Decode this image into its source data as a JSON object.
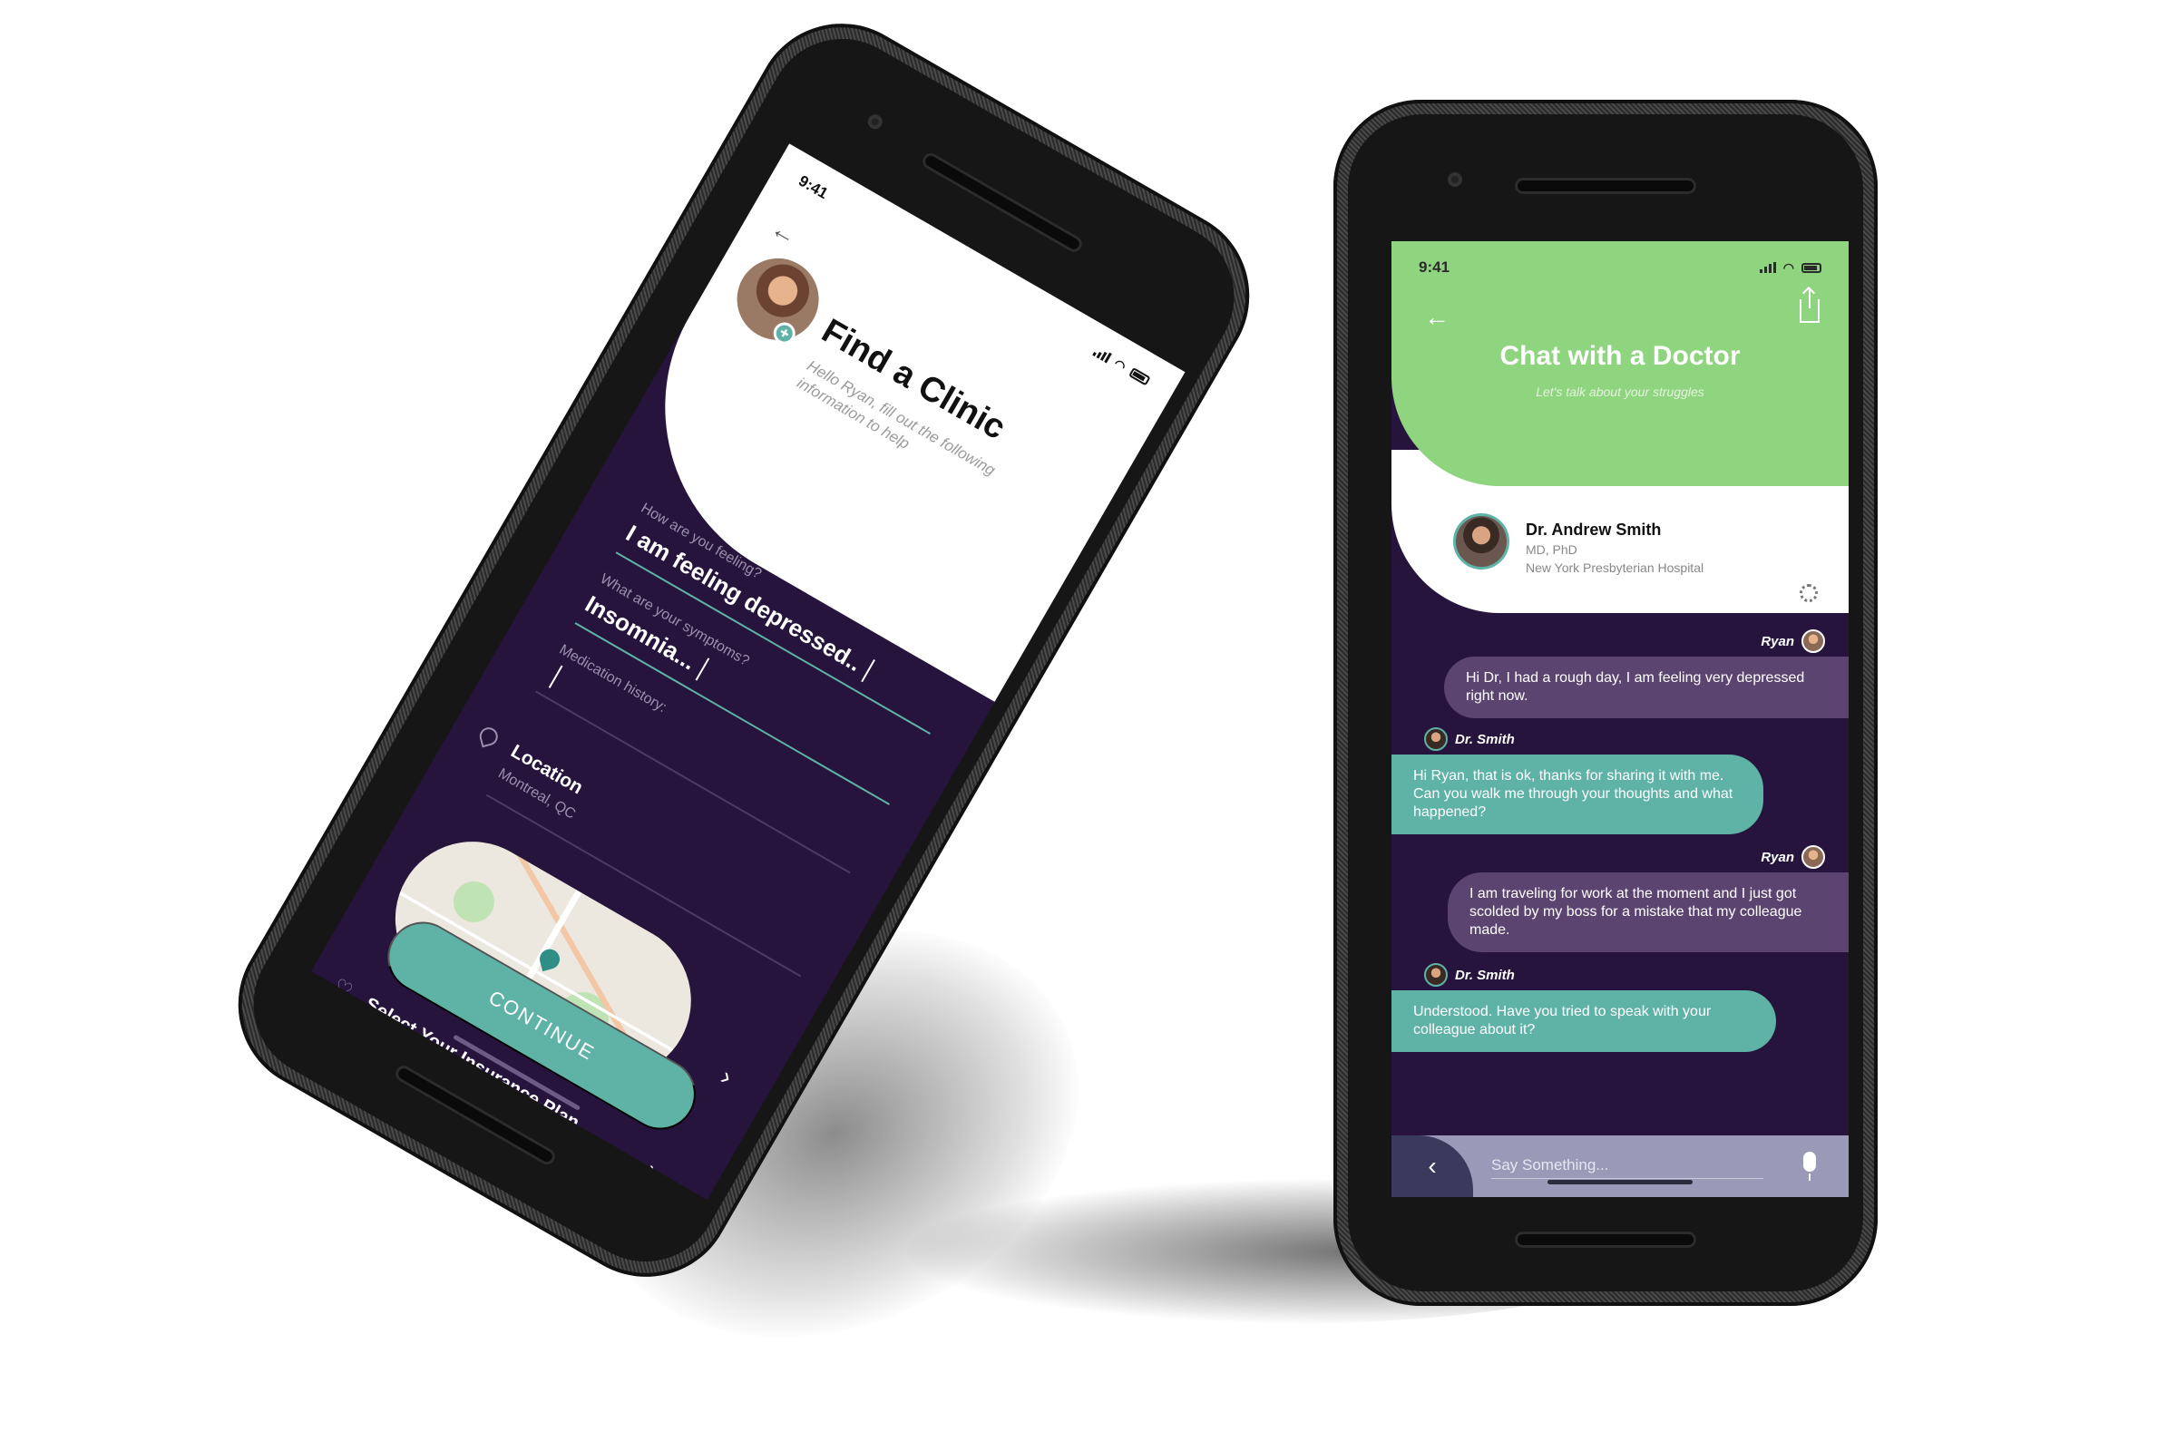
{
  "left_phone": {
    "status_time": "9:41",
    "title": "Find a Clinic",
    "subtitle": "Hello Ryan, fill out the following information to help",
    "fields": [
      {
        "label": "How are you feeling?",
        "value": "I am feeling depressed.."
      },
      {
        "label": "What are your symptoms?",
        "value": "Insomnia..."
      },
      {
        "label": "Medication history:",
        "value": ""
      }
    ],
    "location": {
      "label": "Location",
      "value": "Montreal, QC"
    },
    "insurance_label": "Select Your Insurance Plan",
    "continue_label": "CONTINUE"
  },
  "right_phone": {
    "status_time": "9:41",
    "title": "Chat with a Doctor",
    "subtitle": "Let's talk about your struggles",
    "doctor": {
      "name": "Dr. Andrew Smith",
      "degree": "MD, PhD",
      "hospital": "New York Presbyterian Hospital"
    },
    "messages": [
      {
        "sender": "Ryan",
        "text": "Hi Dr, I had a rough day, I am feeling very depressed right now."
      },
      {
        "sender": "Dr. Smith",
        "text": "Hi Ryan, that is ok, thanks for sharing it with me. Can you walk me through your thoughts and what happened?"
      },
      {
        "sender": "Ryan",
        "text": "I am traveling for work at the moment and I just got scolded by my boss for a mistake that my colleague made."
      },
      {
        "sender": "Dr. Smith",
        "text": "Understood. Have you tried to speak with your colleague about it?"
      }
    ],
    "input_placeholder": "Say Something..."
  },
  "colors": {
    "screen_bg": "#26143c",
    "teal": "#5fb2a6",
    "green_header": "#8fd47f",
    "user_bubble": "#5b4570",
    "input_bar": "#9a99b8"
  }
}
